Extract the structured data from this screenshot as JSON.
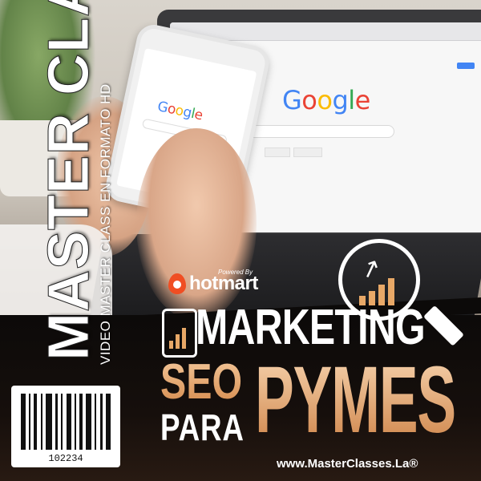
{
  "cover": {
    "vertical_title": "MASTER CLASS",
    "vertical_subtitle": "VIDEO MASTER CLASS EN FORMATO HD",
    "barcode_number": "102234",
    "powered_by": "Powered By",
    "brand": "hotmart",
    "title_line1": "MARKETING",
    "title_line2_accent": "SEO",
    "title_line3": "PARA",
    "title_big": "PYMES",
    "website": "www.MasterClasses.La®"
  },
  "screen": {
    "laptop_search_logo": "Google",
    "phone_search_logo": "Google"
  },
  "colors": {
    "accent": "#e8a867",
    "hotmart": "#f04e23",
    "band": "#0c0a09"
  }
}
